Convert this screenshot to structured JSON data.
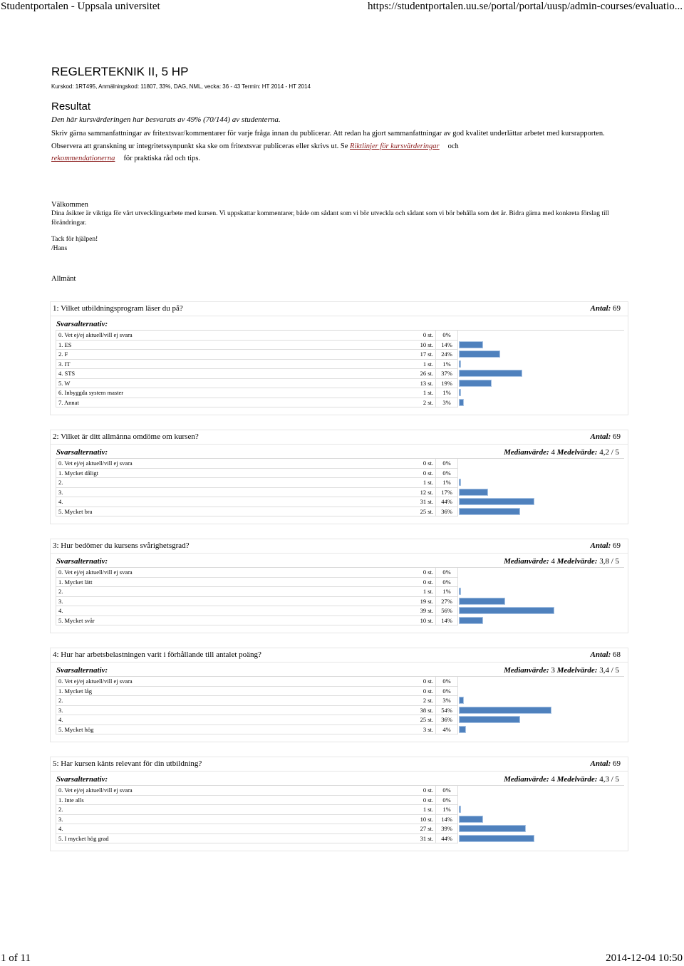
{
  "header": {
    "page_title": "Studentportalen - Uppsala universitet",
    "url": "https://studentportalen.uu.se/portal/portal/uusp/admin-courses/evaluatio..."
  },
  "footer": {
    "page_indicator": "1 of 11",
    "timestamp": "2014-12-04 10:50"
  },
  "course": {
    "title": "REGLERTEKNIK II, 5 HP",
    "meta": "Kurskod: 1RT495,  Anmälningskod: 11807,  33%, DAG, NML, vecka:  36 - 43 Termin:  HT 2014 - HT 2014"
  },
  "result": {
    "title": "Resultat",
    "response_rate": "Den här kursvärderingen har besvarats av 49% (70/144) av studenterna.",
    "instructions_part1": "Skriv gärna sammanfattningar av fritextsvar/kommentarer för varje fråga innan du publicerar. Att redan ha gjort sammanfattningar av god kvalitet underlättar arbetet med kursrapporten. Observera att granskning ur integritetssynpunkt ska ske om fritextsvar publiceras eller skrivs ut. Se ",
    "link1": "Riktlinjer för kursvärderingar",
    "and_word": "och",
    "link2": "rekommendationerna",
    "instructions_part2": "för praktiska råd och tips."
  },
  "welcome": {
    "title": "Välkommen",
    "text": "Dina åsikter är viktiga för vårt utvecklingsarbete med kursen. Vi uppskattar kommentarer, både om sådant som vi bör utveckla och sådant som vi bör behålla som det är. Bidra gärna med konkreta förslag till förändringar.",
    "thanks": "Tack för hjälpen!",
    "signature": "/Hans"
  },
  "section_title": "Allmänt",
  "labels": {
    "count_label": "Antal:",
    "options_label": "Svarsalternativ:",
    "median_label": "Medianvärde:",
    "mean_label": "Medelvärde:"
  },
  "bar_color": "#4f81bd",
  "questions": [
    {
      "title": "1:  Vilket utbildningsprogram läser du på?",
      "count": "69",
      "median": null,
      "mean": null,
      "options": [
        {
          "label": "0.  Vet ej/ej aktuell/vill ej svara",
          "count": "0 st.",
          "pct": "0%",
          "value": 0
        },
        {
          "label": "1.  ES",
          "count": "10 st.",
          "pct": "14%",
          "value": 14
        },
        {
          "label": "2.  F",
          "count": "17 st.",
          "pct": "24%",
          "value": 24
        },
        {
          "label": "3.  IT",
          "count": "1 st.",
          "pct": "1%",
          "value": 1
        },
        {
          "label": "4.  STS",
          "count": "26 st.",
          "pct": "37%",
          "value": 37
        },
        {
          "label": "5.  W",
          "count": "13 st.",
          "pct": "19%",
          "value": 19
        },
        {
          "label": "6.  Inbyggda system master",
          "count": "1 st.",
          "pct": "1%",
          "value": 1
        },
        {
          "label": "7.  Annat",
          "count": "2 st.",
          "pct": "3%",
          "value": 3
        }
      ]
    },
    {
      "title": "2:  Vilket är ditt allmänna omdöme om kursen?",
      "count": "69",
      "median": "4",
      "mean": "4,2 / 5",
      "options": [
        {
          "label": "0.  Vet ej/ej aktuell/vill ej svara",
          "count": "0 st.",
          "pct": "0%",
          "value": 0
        },
        {
          "label": "1.  Mycket dåligt",
          "count": "0 st.",
          "pct": "0%",
          "value": 0
        },
        {
          "label": "2.",
          "count": "1 st.",
          "pct": "1%",
          "value": 1
        },
        {
          "label": "3.",
          "count": "12 st.",
          "pct": "17%",
          "value": 17
        },
        {
          "label": "4.",
          "count": "31 st.",
          "pct": "44%",
          "value": 44
        },
        {
          "label": "5.  Mycket bra",
          "count": "25 st.",
          "pct": "36%",
          "value": 36
        }
      ]
    },
    {
      "title": "3:  Hur bedömer du kursens svårighetsgrad?",
      "count": "69",
      "median": "4",
      "mean": "3,8 / 5",
      "options": [
        {
          "label": "0.  Vet ej/ej aktuell/vill ej svara",
          "count": "0 st.",
          "pct": "0%",
          "value": 0
        },
        {
          "label": "1.  Mycket lätt",
          "count": "0 st.",
          "pct": "0%",
          "value": 0
        },
        {
          "label": "2.",
          "count": "1 st.",
          "pct": "1%",
          "value": 1
        },
        {
          "label": "3.",
          "count": "19 st.",
          "pct": "27%",
          "value": 27
        },
        {
          "label": "4.",
          "count": "39 st.",
          "pct": "56%",
          "value": 56
        },
        {
          "label": "5.  Mycket svår",
          "count": "10 st.",
          "pct": "14%",
          "value": 14
        }
      ]
    },
    {
      "title": "4:  Hur har arbetsbelastningen varit i förhållande till antalet poäng?",
      "count": "68",
      "median": "3",
      "mean": "3,4 / 5",
      "options": [
        {
          "label": "0.  Vet ej/ej aktuell/vill ej svara",
          "count": "0 st.",
          "pct": "0%",
          "value": 0
        },
        {
          "label": "1.  Mycket låg",
          "count": "0 st.",
          "pct": "0%",
          "value": 0
        },
        {
          "label": "2.",
          "count": "2 st.",
          "pct": "3%",
          "value": 3
        },
        {
          "label": "3.",
          "count": "38 st.",
          "pct": "54%",
          "value": 54
        },
        {
          "label": "4.",
          "count": "25 st.",
          "pct": "36%",
          "value": 36
        },
        {
          "label": "5.  Mycket hög",
          "count": "3 st.",
          "pct": "4%",
          "value": 4
        }
      ]
    },
    {
      "title": "5:  Har kursen känts relevant för din utbildning?",
      "count": "69",
      "median": "4",
      "mean": "4,3 / 5",
      "options": [
        {
          "label": "0.  Vet ej/ej aktuell/vill ej svara",
          "count": "0 st.",
          "pct": "0%",
          "value": 0
        },
        {
          "label": "1.  Inte alls",
          "count": "0 st.",
          "pct": "0%",
          "value": 0
        },
        {
          "label": "2.",
          "count": "1 st.",
          "pct": "1%",
          "value": 1
        },
        {
          "label": "3.",
          "count": "10 st.",
          "pct": "14%",
          "value": 14
        },
        {
          "label": "4.",
          "count": "27 st.",
          "pct": "39%",
          "value": 39
        },
        {
          "label": "5.  I mycket hög grad",
          "count": "31 st.",
          "pct": "44%",
          "value": 44
        }
      ]
    }
  ]
}
